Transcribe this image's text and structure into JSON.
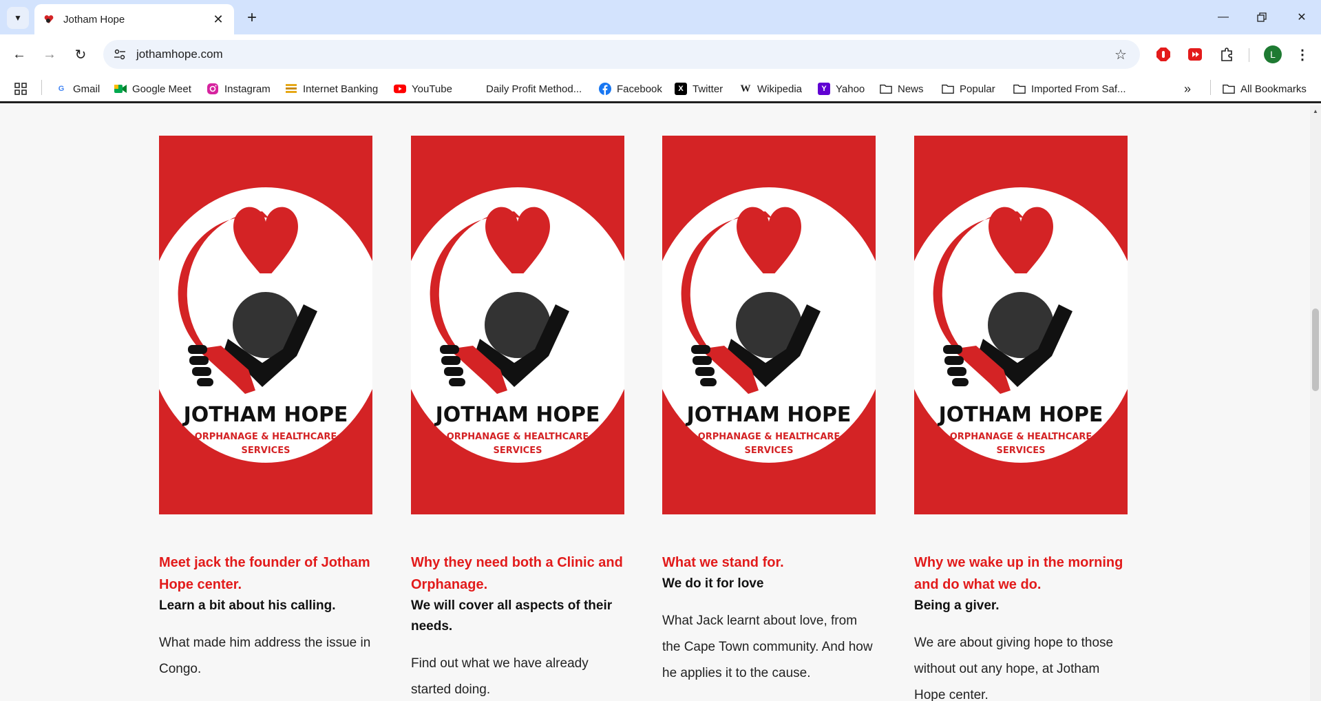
{
  "browser": {
    "tab_title": "Jotham Hope",
    "url": "jothamhope.com",
    "profile_initial": "L"
  },
  "bookmarks": [
    {
      "label": "Gmail",
      "icon": "google-icon"
    },
    {
      "label": "Google Meet",
      "icon": "google-meet-icon"
    },
    {
      "label": "Instagram",
      "icon": "instagram-icon"
    },
    {
      "label": "Internet Banking",
      "icon": "bank-icon"
    },
    {
      "label": "YouTube",
      "icon": "youtube-icon"
    },
    {
      "label": "Daily Profit Method...",
      "icon": "blank-icon"
    },
    {
      "label": "Facebook",
      "icon": "facebook-icon"
    },
    {
      "label": "Twitter",
      "icon": "x-icon"
    },
    {
      "label": "Wikipedia",
      "icon": "wikipedia-icon"
    },
    {
      "label": "Yahoo",
      "icon": "yahoo-icon"
    },
    {
      "label": "News",
      "icon": "folder-icon"
    },
    {
      "label": "Popular",
      "icon": "folder-icon"
    },
    {
      "label": "Imported From Saf...",
      "icon": "folder-icon"
    }
  ],
  "all_bookmarks_label": "All Bookmarks",
  "logo": {
    "title": "JOTHAM HOPE",
    "line2": "ORPHANAGE & HEALTHCARE",
    "line3": "SERVICES"
  },
  "colors": {
    "brand_red": "#d42325",
    "heading_red": "#e21b1b"
  },
  "cards": [
    {
      "heading": "Meet jack the founder of Jotham Hope center.",
      "subheading": "Learn a bit about his calling.",
      "body": "What made him address the issue in Congo."
    },
    {
      "heading": "Why they need both a Clinic and Orphanage.",
      "subheading": "We will cover all aspects of their needs.",
      "body": "Find out what we have already started doing."
    },
    {
      "heading": "What we stand for.",
      "subheading": "We do it for love",
      "body": "What Jack learnt about love, from the Cape Town community. And how he applies it to the cause."
    },
    {
      "heading": "Why we wake up in the morning and do what we do.",
      "subheading": "Being a giver.",
      "body": "We are about giving hope to those without out any hope, at Jotham Hope center."
    }
  ]
}
